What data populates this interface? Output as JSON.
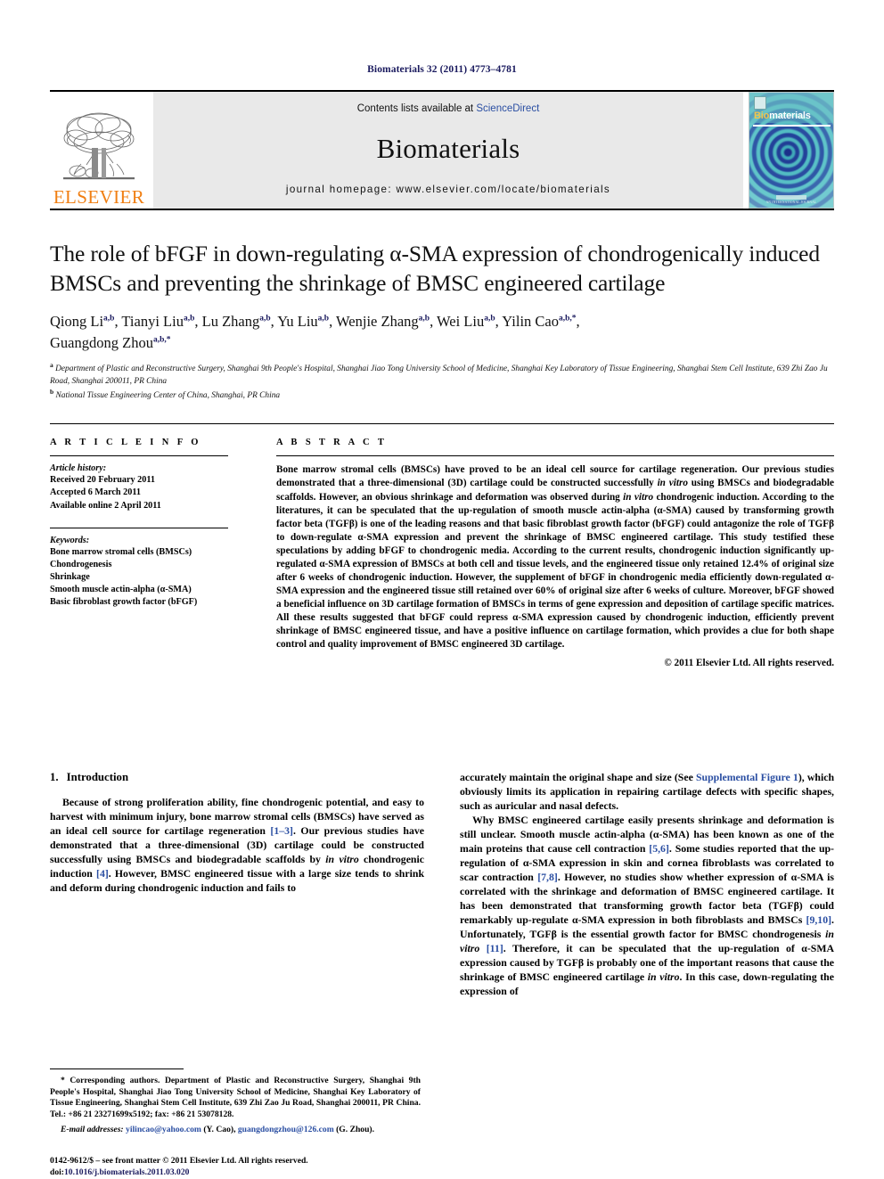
{
  "running_head": "Biomaterials 32 (2011) 4773–4781",
  "masthead": {
    "publisher_name": "ELSEVIER",
    "contents_prefix": "Contents lists available at ",
    "contents_link": "ScienceDirect",
    "journal_name": "Biomaterials",
    "homepage_line": "journal homepage: www.elsevier.com/locate/biomaterials",
    "cover_title_a": "Bio",
    "cover_title_b": "materials",
    "cover_footer": "AN INTERNATIONAL JOURNAL"
  },
  "article": {
    "title": "The role of bFGF in down-regulating α-SMA expression of chondrogenically induced BMSCs and preventing the shrinkage of BMSC engineered cartilage",
    "authors_line1": "Qiong Li a,b, Tianyi Liu a,b, Lu Zhang a,b, Yu Liu a,b, Wenjie Zhang a,b, Wei Liu a,b, Yilin Cao a,b,*,",
    "authors_line2": "Guangdong Zhou a,b,*",
    "affiliation_a": "Department of Plastic and Reconstructive Surgery, Shanghai 9th People's Hospital, Shanghai Jiao Tong University School of Medicine, Shanghai Key Laboratory of Tissue Engineering, Shanghai Stem Cell Institute, 639 Zhi Zao Ju Road, Shanghai 200011, PR China",
    "affiliation_b": "National Tissue Engineering Center of China, Shanghai, PR China"
  },
  "article_info": {
    "heading": "A R T I C L E    I N F O",
    "history_label": "Article history:",
    "history": [
      "Received 20 February 2011",
      "Accepted 6 March 2011",
      "Available online 2 April 2011"
    ],
    "keywords_label": "Keywords:",
    "keywords": [
      "Bone marrow stromal cells (BMSCs)",
      "Chondrogenesis",
      "Shrinkage",
      "Smooth muscle actin-alpha (α-SMA)",
      "Basic fibroblast growth factor (bFGF)"
    ]
  },
  "abstract": {
    "heading": "A B S T R A C T",
    "copyright": "© 2011 Elsevier Ltd. All rights reserved."
  },
  "introduction": {
    "number": "1.",
    "heading": "Introduction"
  },
  "footnote": {
    "corresponding": "* Corresponding authors. Department of Plastic and Reconstructive Surgery, Shanghai 9th People's Hospital, Shanghai Jiao Tong University School of Medicine, Shanghai Key Laboratory of Tissue Engineering, Shanghai Stem Cell Institute, 639 Zhi Zao Ju Road, Shanghai 200011, PR China. Tel.: +86 21 23271699x5192; fax: +86 21 53078128.",
    "email_label": "E-mail addresses:",
    "email1": "yilincao@yahoo.com",
    "email1_owner": "(Y. Cao),",
    "email2": "guangdongzhou@126.com",
    "email2_owner": "(G. Zhou)."
  },
  "imprint": {
    "line1": "0142-9612/$ – see front matter © 2011 Elsevier Ltd. All rights reserved.",
    "doi_label": "doi:",
    "doi": "10.1016/j.biomaterials.2011.03.020"
  },
  "colors": {
    "elsevier_orange": "#f07f13",
    "link_blue": "#2a4ea2",
    "header_navy": "#1a1a5e"
  }
}
